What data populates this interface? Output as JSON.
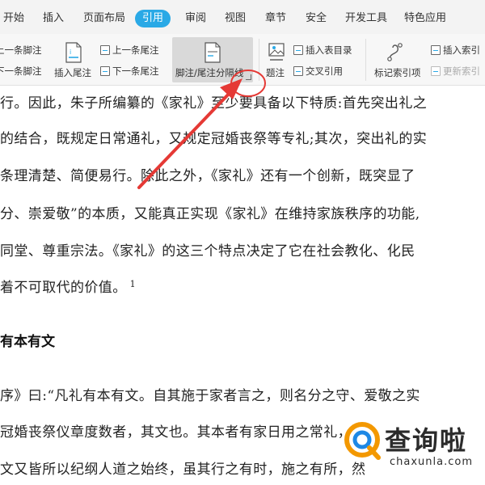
{
  "menu": {
    "tabs": [
      {
        "label": "开始"
      },
      {
        "label": "插入"
      },
      {
        "label": "页面布局"
      },
      {
        "label": "引用",
        "active": true
      },
      {
        "label": "审阅"
      },
      {
        "label": "视图"
      },
      {
        "label": "章节"
      },
      {
        "label": "安全"
      },
      {
        "label": "开发工具"
      },
      {
        "label": "特色应用"
      }
    ]
  },
  "ribbon": {
    "prev_footnote": "上一条脚注",
    "next_footnote": "下一条脚注",
    "insert_endnote": "插入尾注",
    "prev_endnote": "上一条尾注",
    "next_endnote": "下一条尾注",
    "footnote_separator": "脚注/尾注分隔线",
    "caption": "题注",
    "insert_table_of_figures": "插入表目录",
    "cross_reference": "交叉引用",
    "mark_index_entry": "标记索引项",
    "insert_index": "插入索引",
    "update_index": "更新索引"
  },
  "document": {
    "lines": [
      "行。因此，朱子所编纂的《家礼》至少要具备以下特质:首先突出礼之",
      "的结合，既规定日常通礼，又规定冠婚丧祭等专礼;其次，突出礼的实",
      "条理清楚、简便易行。除此之外，《家礼》还有一个创新，既突显了",
      "分、崇爱敬”的本质，又能真正实现《家礼》在维持家族秩序的功能,",
      "同堂、尊重宗法。《家礼》的这三个特点决定了它在社会教化、化民",
      "着不可取代的价值。"
    ],
    "footnote_ref": "1",
    "heading": "有本有文",
    "lines2": [
      "序》曰:“凡礼有本有文。自其施于家者言之，则名分之守、爱敬之实",
      "冠婚丧祭仪章度数者，其文也。其本者有家日用之常礼，",
      "文又皆所以纪纲人道之始终，虽其行之有时，施之有所，然"
    ]
  },
  "watermark": {
    "brand": "查询啦",
    "domain": "chaxunla.com"
  },
  "colors": {
    "accent": "#2aa9e6",
    "annotation": "#e53935",
    "watermark_orange": "#f39800",
    "watermark_blue": "#1e88e5"
  }
}
